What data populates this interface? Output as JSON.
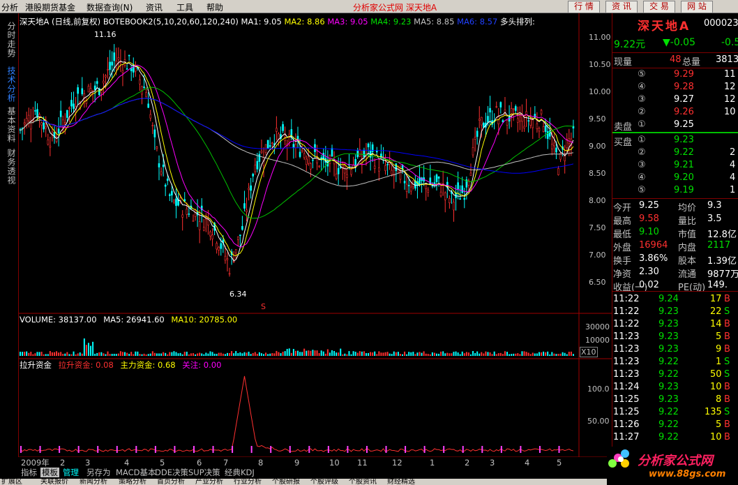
{
  "menubar": {
    "items": [
      "分析",
      "港股期货基金",
      "数据查询(N)",
      "资讯",
      "工具",
      "帮助"
    ],
    "center_title": "分析家公式网  深天地A",
    "buttons": [
      "行 情",
      "资 讯",
      "交 易",
      "网 站"
    ]
  },
  "left_tabs": [
    "分时走势",
    "技术分析",
    "基本资料",
    "财务透视"
  ],
  "chart": {
    "header": {
      "name": "深天地A",
      "period": "(日线,前复权)",
      "formula": "BOTEBOOK2(5,10,20,60,120,240)",
      "ma1": "MA1: 9.05",
      "ma2": "MA2: 8.86",
      "ma3": "MA3: 9.05",
      "ma4": "MA4: 9.23",
      "ma5": "MA5: 8.85",
      "ma6": "MA6: 8.57",
      "multi": "多头排列:"
    },
    "price_axis": [
      "11.00",
      "10.50",
      "10.00",
      "9.50",
      "9.00",
      "8.50",
      "8.00",
      "7.50",
      "7.00",
      "6.50"
    ],
    "high_label": "11.16",
    "low_label": "6.34",
    "s_marker": "S",
    "volume_header": {
      "vol": "VOLUME: 38137.00",
      "ma5": "MA5: 26941.60",
      "ma10": "MA10: 20785.00"
    },
    "volume_axis": [
      "30000",
      "10000"
    ],
    "volume_unit": "X10",
    "fund_header": {
      "name": "拉升资金",
      "lift": "拉升资金: 0.08",
      "main": "主力资金: 0.68",
      "watch": "关注: 0.00"
    },
    "fund_axis": [
      "100.0",
      "50.00"
    ],
    "time_axis": [
      "2009年",
      "2",
      "3",
      "4",
      "5",
      "6",
      "7",
      "8",
      "9",
      "10",
      "11",
      "12",
      "1",
      "2",
      "3",
      "4",
      "5"
    ]
  },
  "panel": {
    "title": "深天地A",
    "code": "000023",
    "price": "9.22元",
    "change": "▼-0.05",
    "change_pct": "-0.5",
    "vol_now_label": "现量",
    "vol_now": "48",
    "vol_total_label": "总量",
    "vol_total": "3813",
    "sells": [
      {
        "n": "⑤",
        "p": "9.29",
        "v": "11"
      },
      {
        "n": "④",
        "p": "9.28",
        "v": "12"
      },
      {
        "n": "③",
        "p": "9.27",
        "v": "12"
      },
      {
        "n": "②",
        "p": "9.26",
        "v": "10"
      },
      {
        "n": "①",
        "p": "9.25",
        "v": ""
      }
    ],
    "sell_label": "卖盘",
    "buy_label": "买盘",
    "buys": [
      {
        "n": "①",
        "p": "9.23",
        "v": ""
      },
      {
        "n": "②",
        "p": "9.22",
        "v": "2"
      },
      {
        "n": "③",
        "p": "9.21",
        "v": "4"
      },
      {
        "n": "④",
        "p": "9.20",
        "v": "4"
      },
      {
        "n": "⑤",
        "p": "9.19",
        "v": "1"
      }
    ],
    "stats": [
      {
        "l1": "今开",
        "v1": "9.25",
        "l2": "均价",
        "v2": "9.3"
      },
      {
        "l1": "最高",
        "v1": "9.58",
        "l2": "量比",
        "v2": "3.5"
      },
      {
        "l1": "最低",
        "v1": "9.10",
        "l2": "市值",
        "v2": "12.8亿"
      },
      {
        "l1": "外盘",
        "v1": "16964",
        "l2": "内盘",
        "v2": "2117"
      },
      {
        "l1": "换手",
        "v1": "3.86%",
        "l2": "股本",
        "v2": "1.39亿"
      },
      {
        "l1": "净资",
        "v1": "2.30",
        "l2": "流通",
        "v2": "9877万"
      },
      {
        "l1": "收益(一)",
        "v1": "0.02",
        "l2": "PE(动)",
        "v2": "149."
      }
    ],
    "ticks": [
      {
        "t": "11:22",
        "p": "9.24",
        "v": "17",
        "s": "B"
      },
      {
        "t": "11:22",
        "p": "9.23",
        "v": "22",
        "s": "S"
      },
      {
        "t": "11:22",
        "p": "9.23",
        "v": "14",
        "s": "B"
      },
      {
        "t": "11:23",
        "p": "9.23",
        "v": "5",
        "s": "B"
      },
      {
        "t": "11:23",
        "p": "9.23",
        "v": "9",
        "s": "B"
      },
      {
        "t": "11:23",
        "p": "9.22",
        "v": "1",
        "s": "S"
      },
      {
        "t": "11:23",
        "p": "9.22",
        "v": "50",
        "s": "S"
      },
      {
        "t": "11:24",
        "p": "9.23",
        "v": "10",
        "s": "B"
      },
      {
        "t": "11:25",
        "p": "9.23",
        "v": "8",
        "s": "B"
      },
      {
        "t": "11:25",
        "p": "9.22",
        "v": "135",
        "s": "S"
      },
      {
        "t": "11:26",
        "p": "9.22",
        "v": "5",
        "s": "B"
      },
      {
        "t": "11:27",
        "p": "9.22",
        "v": "10",
        "s": "B"
      }
    ]
  },
  "bottom_tabs": [
    "指标",
    "模板",
    "管理",
    "另存为",
    "MACD基本",
    "DDE决策",
    "SUP决策",
    "经典KDJ"
  ],
  "footer_tabs": [
    "扩展区",
    "关联报价",
    "新闻分析",
    "策略分析",
    "首页分析",
    "产业分析",
    "行业分析",
    "个股研报",
    "个股评级",
    "个股资讯",
    "财经精选"
  ],
  "logo": {
    "name": "分析家公式网",
    "url": "www.88gs.com"
  },
  "colors": {
    "up": "#ff3030",
    "down": "#00e000",
    "ma1": "#ffffff",
    "ma2": "#ffff00",
    "ma3": "#ff00ff",
    "ma4": "#00c000",
    "ma5": "#c0c0c0",
    "ma6": "#0000ff"
  }
}
